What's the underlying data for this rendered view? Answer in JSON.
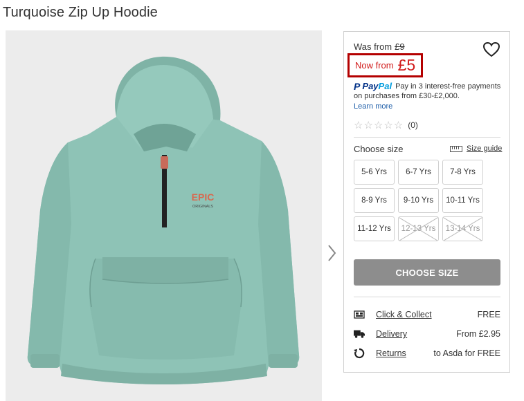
{
  "page": {
    "title": "Turquoise Zip Up Hoodie"
  },
  "image": {
    "alt_icon": "hoodie-image",
    "print_text": "EPIC",
    "print_sub": "ORIGINALS"
  },
  "pricing": {
    "was_label": "Was from",
    "was_price": "£9",
    "now_label": "Now from",
    "now_price": "£5"
  },
  "paypal": {
    "brand": "PayPal",
    "message": "Pay in 3 interest-free payments on purchases from £30-£2,000.",
    "learn_more": "Learn more"
  },
  "rating": {
    "stars_text": "☆☆☆☆☆",
    "count": "(0)"
  },
  "size": {
    "label": "Choose size",
    "guide_label": "Size guide",
    "options": [
      {
        "label": "5-6 Yrs",
        "available": true
      },
      {
        "label": "6-7 Yrs",
        "available": true
      },
      {
        "label": "7-8 Yrs",
        "available": true
      },
      {
        "label": "8-9 Yrs",
        "available": true
      },
      {
        "label": "9-10 Yrs",
        "available": true
      },
      {
        "label": "10-11 Yrs",
        "available": true
      },
      {
        "label": "11-12 Yrs",
        "available": true
      },
      {
        "label": "12-13 Yrs",
        "available": false
      },
      {
        "label": "13-14 Yrs",
        "available": false
      }
    ]
  },
  "cta": {
    "choose_size": "CHOOSE SIZE"
  },
  "delivery": {
    "click_collect_label": "Click & Collect",
    "click_collect_value": "FREE",
    "delivery_label": "Delivery",
    "delivery_value": "From £2.95",
    "returns_label": "Returns",
    "returns_value": "to Asda for FREE"
  },
  "colors": {
    "hoodie": "#8ec3b6",
    "price_red": "#d11b1b",
    "highlight_border": "#b40000",
    "button_gray": "#8d8d8d",
    "paypal_dark": "#003087",
    "paypal_light": "#009cde"
  }
}
